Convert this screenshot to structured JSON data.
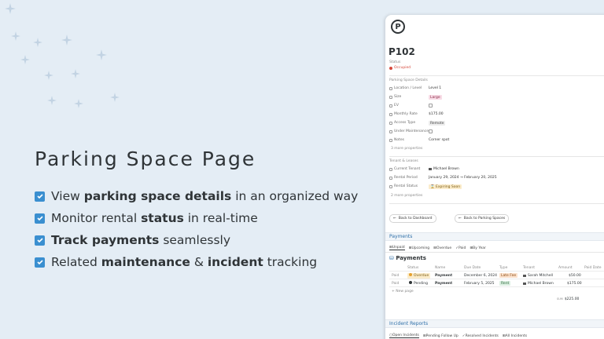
{
  "hero": {
    "title": "Parking Space Page",
    "features": [
      {
        "pre": "View ",
        "bold": "parking space details",
        "post": " in an organized way"
      },
      {
        "pre": "Monitor rental ",
        "bold": "status",
        "post": " in real-time"
      },
      {
        "pre": "",
        "bold": "Track payments",
        "post": " seamlessly"
      },
      {
        "pre": "Related ",
        "bold": "maintenance",
        "mid": " & ",
        "bold2": "incident",
        "post": " tracking"
      }
    ]
  },
  "page": {
    "logo_letter": "P",
    "title": "P102",
    "status_label": "Status",
    "status_value": "Occupied",
    "details_heading": "Parking Space Details",
    "properties": [
      {
        "label": "Location / Level",
        "value": "Level 1"
      },
      {
        "label": "Size",
        "value": "Large"
      },
      {
        "label": "EV",
        "value": ""
      },
      {
        "label": "Monthly Rate",
        "value": "$175.00"
      },
      {
        "label": "Access Type",
        "value": "Remote"
      },
      {
        "label": "Under Maintenance",
        "value": ""
      },
      {
        "label": "Notes",
        "value": "Corner spot"
      }
    ],
    "more_props_1": "3 more properties",
    "tenant_heading": "Tenant & Leases",
    "tenant_props": [
      {
        "label": "Current Tenant",
        "value": "Michael Brown"
      },
      {
        "label": "Rental Period",
        "value": "January 29, 2024 → February 20, 2025"
      },
      {
        "label": "Rental Status",
        "value": "Expiring Soon"
      }
    ],
    "more_props_2": "2 more properties",
    "back_dashboard": "Back to Dashboard",
    "back_spaces": "Back to Parking Spaces"
  },
  "payments": {
    "section_label": "Payments",
    "tabs": [
      "Unpaid",
      "Upcoming",
      "Overdue",
      "Paid",
      "By Year"
    ],
    "db_title": "Payments",
    "columns": [
      "Status",
      "Name",
      "Due Date",
      "Type",
      "Tenant",
      "Amount",
      "Paid Date"
    ],
    "rows": [
      {
        "flag": "Paid",
        "status": "Overdue",
        "name": "Payment",
        "due": "December 6, 2024",
        "type": "Late Fee",
        "tenant": "Sarah Mitchell",
        "amount": "$50.00"
      },
      {
        "flag": "Paid",
        "status": "Pending",
        "name": "Payment",
        "due": "February 5, 2025",
        "type": "Rent",
        "tenant": "Michael Brown",
        "amount": "$175.00"
      }
    ],
    "new_page": "New page",
    "sum_label": "SUM",
    "sum_value": "$225.00"
  },
  "incidents": {
    "section_label": "Incident Reports",
    "tabs": [
      "Open Incidents",
      "Pending Follow Up",
      "Resolved Incidents",
      "All Incidents"
    ]
  },
  "colors": {
    "accent": "#3a8fd0",
    "background": "#e4edf5",
    "occupied": "#d6483b",
    "overdue": "#e6a12e",
    "pending": "#2f3437"
  }
}
